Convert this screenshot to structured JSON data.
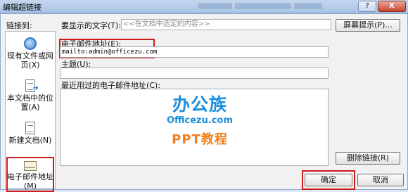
{
  "window": {
    "title": "编辑超链接",
    "help_label": "?",
    "close_label": "X"
  },
  "sidebar": {
    "heading": "链接到:",
    "items": [
      {
        "label": "现有文件或网页(X)"
      },
      {
        "label": "本文档中的位置(A)"
      },
      {
        "label": "新建文档(N)"
      },
      {
        "label": "电子邮件地址(M)"
      }
    ]
  },
  "display_text": {
    "label": "要显示的文字(T):",
    "value": "<<在文档中选定的内容>>"
  },
  "screentip_button": "屏幕提示(P)...",
  "email": {
    "label": "电子邮件地址(E):",
    "value": "mailto:admin@officezu.com"
  },
  "subject": {
    "label": "主题(U):",
    "value": ""
  },
  "recent": {
    "label": "最近用过的电子邮件地址(C):"
  },
  "watermark": {
    "main": "办公族",
    "sub": "Officezu.com",
    "ppt": "PPT教程"
  },
  "remove_link_button": "删除链接(R)",
  "ok_button": "确定",
  "cancel_button": "取消"
}
